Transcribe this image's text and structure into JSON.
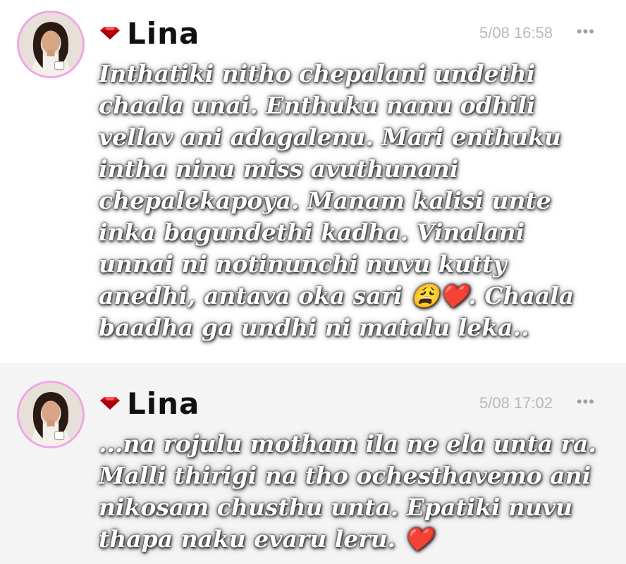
{
  "messages": [
    {
      "username": "Lina",
      "time": "5/08 16:58",
      "more": "•••",
      "text": "Inthatiki nitho chepalani undethi\nchaala unai. Enthuku nanu odhili\nvellav ani adagalenu. Mari enthuku\nintha ninu miss avuthunani\nchepalekapoya. Manam kalisi unte\ninka bagundethi kadha. Vinalani\nunnai ni notinunchi nuvu kutty\nanedhi, antava oka sari 😩❤️. Chaala\nbaadha ga undhi ni matalu leka.."
    },
    {
      "username": "Lina",
      "time": "5/08 17:02",
      "more": "•••",
      "text": "...na rojulu motham ila ne ela unta ra.\nMalli thirigi na tho ochesthavemo ani\nnikosam chusthu unta. Epatiki nuvu\nthapa naku evaru leru. ❤️"
    }
  ],
  "colors": {
    "avatar_ring": "#f0a6e8",
    "gem": "#d8101c",
    "second_bg": "#f4f4f4",
    "time": "#b8b8b8"
  },
  "icons": [
    "ruby-gem-icon",
    "more-options-icon"
  ]
}
